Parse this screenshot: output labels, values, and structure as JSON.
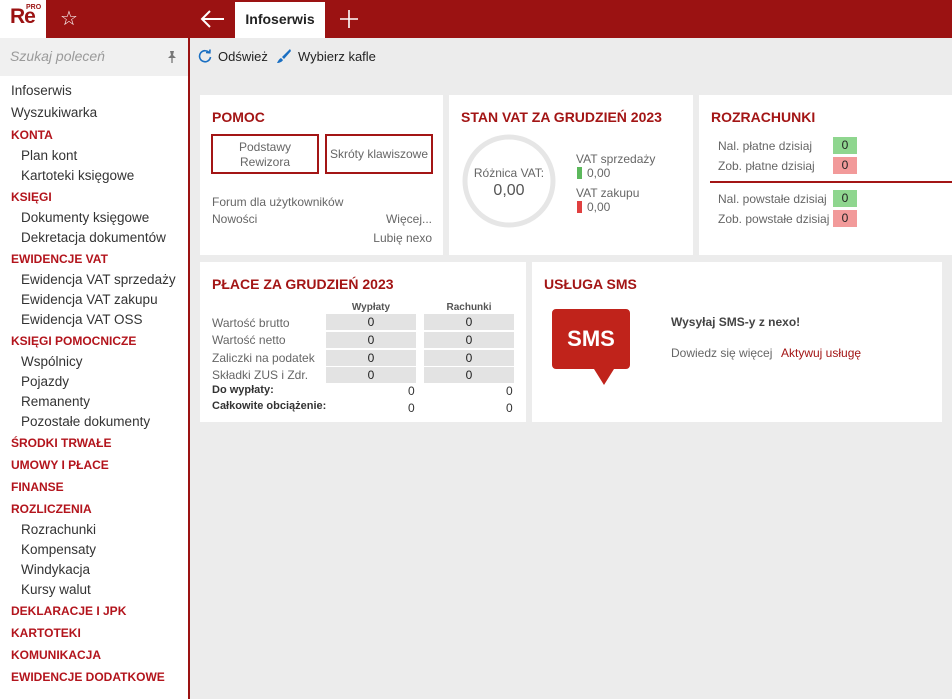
{
  "app": {
    "logo_text": "Re",
    "logo_sup": "PRO"
  },
  "tabs": {
    "active": "Infoserwis"
  },
  "sidebar": {
    "search_placeholder": "Szukaj poleceń",
    "items": [
      {
        "label": "Infoserwis",
        "type": "top"
      },
      {
        "label": "Wyszukiwarka",
        "type": "top"
      },
      {
        "label": "KONTA",
        "type": "sec"
      },
      {
        "label": "Plan kont",
        "type": "sub"
      },
      {
        "label": "Kartoteki księgowe",
        "type": "sub"
      },
      {
        "label": "KSIĘGI",
        "type": "sec"
      },
      {
        "label": "Dokumenty księgowe",
        "type": "sub"
      },
      {
        "label": "Dekretacja dokumentów",
        "type": "sub"
      },
      {
        "label": "EWIDENCJE VAT",
        "type": "sec"
      },
      {
        "label": "Ewidencja VAT sprzedaży",
        "type": "sub"
      },
      {
        "label": "Ewidencja VAT zakupu",
        "type": "sub"
      },
      {
        "label": "Ewidencja VAT OSS",
        "type": "sub"
      },
      {
        "label": "KSIĘGI POMOCNICZE",
        "type": "sec"
      },
      {
        "label": "Wspólnicy",
        "type": "sub"
      },
      {
        "label": "Pojazdy",
        "type": "sub"
      },
      {
        "label": "Remanenty",
        "type": "sub"
      },
      {
        "label": "Pozostałe dokumenty",
        "type": "sub"
      },
      {
        "label": "ŚRODKI TRWAŁE",
        "type": "sec"
      },
      {
        "label": "UMOWY I PŁACE",
        "type": "sec"
      },
      {
        "label": "FINANSE",
        "type": "sec"
      },
      {
        "label": "ROZLICZENIA",
        "type": "sec"
      },
      {
        "label": "Rozrachunki",
        "type": "sub"
      },
      {
        "label": "Kompensaty",
        "type": "sub"
      },
      {
        "label": "Windykacja",
        "type": "sub"
      },
      {
        "label": "Kursy walut",
        "type": "sub"
      },
      {
        "label": "DEKLARACJE I JPK",
        "type": "sec"
      },
      {
        "label": "KARTOTEKI",
        "type": "sec"
      },
      {
        "label": "KOMUNIKACJA",
        "type": "sec"
      },
      {
        "label": "EWIDENCJE DODATKOWE",
        "type": "sec"
      }
    ]
  },
  "toolbar": {
    "refresh": "Odśwież",
    "tiles": "Wybierz kafle"
  },
  "pomoc": {
    "title": "POMOC",
    "btn_basics_1": "Podstawy",
    "btn_basics_2": "Rewizora",
    "btn_shortcuts": "Skróty klawiszowe",
    "forum": "Forum dla użytkowników",
    "news": "Nowości",
    "more": "Więcej...",
    "like": "Lubię nexo"
  },
  "vat": {
    "title": "STAN VAT ZA GRUDZIEŃ 2023",
    "diff_label": "Różnica VAT:",
    "diff_value": "0,00",
    "sales_label": "VAT sprzedaży",
    "sales_value": "0,00",
    "purchase_label": "VAT zakupu",
    "purchase_value": "0,00",
    "colors": {
      "sales": "#5cb85c",
      "purchase": "#e04040"
    }
  },
  "rozrachunki": {
    "title": "ROZRACHUNKI",
    "rows": [
      {
        "label": "Nal. płatne dzisiaj",
        "value": "0",
        "color": "green"
      },
      {
        "label": "Zob. płatne dzisiaj",
        "value": "0",
        "color": "red"
      },
      {
        "label": "Nal. powstałe dzisiaj",
        "value": "0",
        "color": "green"
      },
      {
        "label": "Zob. powstałe dzisiaj",
        "value": "0",
        "color": "red"
      }
    ]
  },
  "place": {
    "title": "PŁACE ZA GRUDZIEŃ 2023",
    "col_wyplaty": "Wypłaty",
    "col_rachunki": "Rachunki",
    "rows": [
      {
        "label": "Wartość brutto",
        "wyplaty": "0",
        "rachunki": "0"
      },
      {
        "label": "Wartość netto",
        "wyplaty": "0",
        "rachunki": "0"
      },
      {
        "label": "Zaliczki na podatek",
        "wyplaty": "0",
        "rachunki": "0"
      },
      {
        "label": "Składki ZUS i Zdr.",
        "wyplaty": "0",
        "rachunki": "0"
      }
    ],
    "total_payout_label": "Do wypłaty:",
    "total_payout_w": "0",
    "total_payout_r": "0",
    "total_cost_label": "Całkowite obciążenie:",
    "total_cost_w": "0",
    "total_cost_r": "0"
  },
  "sms": {
    "title": "USŁUGA SMS",
    "logo": "SMS",
    "headline": "Wysyłaj SMS-y z nexo!",
    "learn_more": "Dowiedz się więcej",
    "activate": "Aktywuj usługę"
  },
  "colors": {
    "brand": "#9b1212",
    "accent": "#a31515"
  }
}
